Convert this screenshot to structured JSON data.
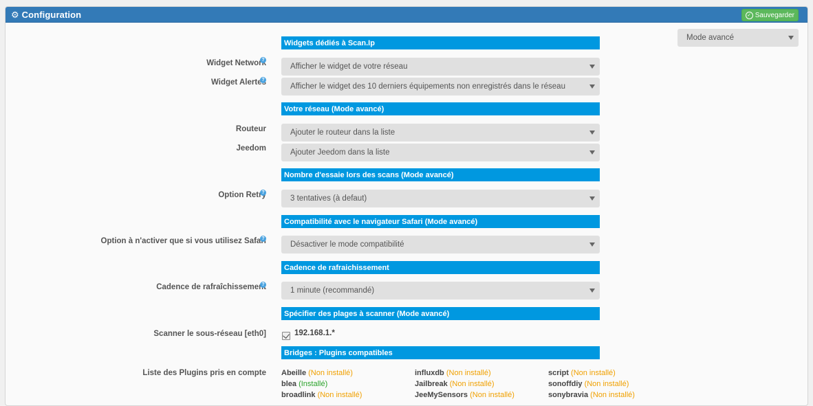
{
  "header": {
    "title": "Configuration",
    "save_label": "Sauvegarder",
    "accent_color": "#337ab7"
  },
  "mode_select": {
    "value": "Mode avancé"
  },
  "sections": {
    "widgets": "Widgets dédiés à Scan.Ip",
    "network": "Votre réseau (Mode avancé)",
    "retry": "Nombre d'essaie lors des scans (Mode avancé)",
    "safari": "Compatibilité avec le navigateur Safari (Mode avancé)",
    "cadence": "Cadence de rafraichissement",
    "ranges": "Spécifier des plages à scanner (Mode avancé)",
    "bridges": "Bridges : Plugins compatibles"
  },
  "fields": {
    "widget_network": {
      "label": "Widget Network",
      "value": "Afficher le widget de votre réseau"
    },
    "widget_alertes": {
      "label": "Widget Alertes",
      "value": "Afficher le widget des 10 derniers équipements non enregistrés dans le réseau"
    },
    "routeur": {
      "label": "Routeur",
      "value": "Ajouter le routeur dans la liste"
    },
    "jeedom": {
      "label": "Jeedom",
      "value": "Ajouter Jeedom dans la liste"
    },
    "retry": {
      "label": "Option Retry",
      "value": "3 tentatives (à defaut)"
    },
    "safari": {
      "label": "Option à n'activer que si vous utilisez Safari",
      "value": "Désactiver le mode compatibilité"
    },
    "cadence": {
      "label": "Cadence de rafraîchissement",
      "value": "1 minute (recommandé)"
    },
    "subnet": {
      "label": "Scanner le sous-réseau [eth0]",
      "value": "192.168.1.*"
    },
    "plugins_label": "Liste des Plugins pris en compte"
  },
  "plugins": [
    {
      "name": "Abeille",
      "status": "(Non installé)",
      "installed": false
    },
    {
      "name": "blea",
      "status": "(Installé)",
      "installed": true
    },
    {
      "name": "broadlink",
      "status": "(Non installé)",
      "installed": false
    },
    {
      "name": "influxdb",
      "status": "(Non installé)",
      "installed": false
    },
    {
      "name": "Jailbreak",
      "status": "(Non installé)",
      "installed": false
    },
    {
      "name": "JeeMySensors",
      "status": "(Non installé)",
      "installed": false
    },
    {
      "name": "script",
      "status": "(Non installé)",
      "installed": false
    },
    {
      "name": "sonoffdiy",
      "status": "(Non installé)",
      "installed": false
    },
    {
      "name": "sonybravia",
      "status": "(Non installé)",
      "installed": false
    }
  ],
  "icons": {
    "header": "gears-icon",
    "save": "check-circle-icon",
    "help": "question-circle-icon",
    "dropdown": "caret-down-icon"
  },
  "colors": {
    "section": "#0098e0",
    "installed": "#2aa22a",
    "not_installed": "#f0a000",
    "save": "#5cb85c"
  }
}
